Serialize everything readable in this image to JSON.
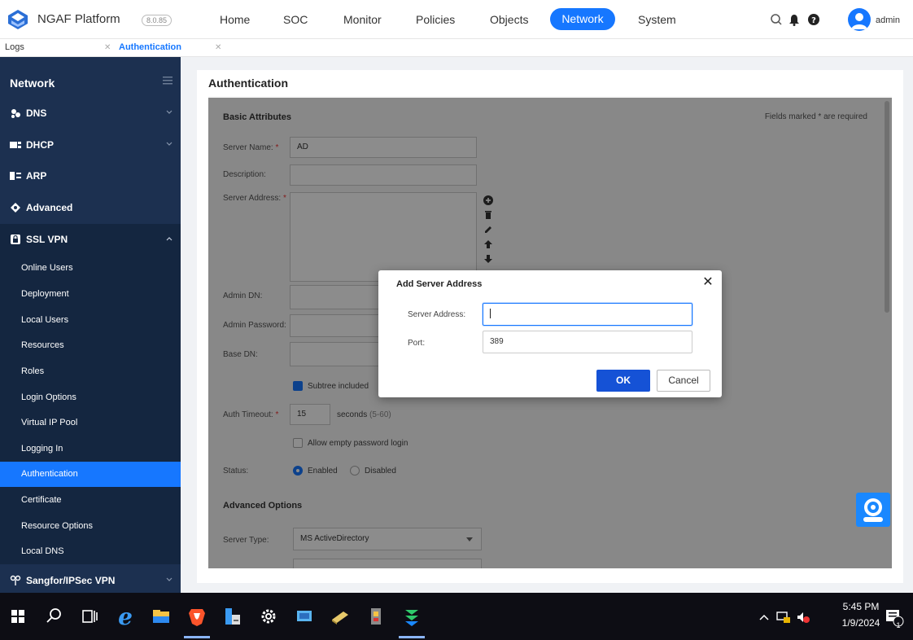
{
  "header": {
    "brand": "NGAF Platform",
    "version": "8.0.85",
    "nav": [
      "Home",
      "SOC",
      "Monitor",
      "Policies",
      "Objects",
      "Network",
      "System"
    ],
    "active_nav": "Network",
    "user": "admin",
    "accent": "#1677ff"
  },
  "tabs": [
    {
      "label": "Logs",
      "active": false
    },
    {
      "label": "Authentication",
      "active": true
    }
  ],
  "sidebar": {
    "title": "Network",
    "sections": [
      {
        "label": "DNS",
        "icon": "dns-icon"
      },
      {
        "label": "DHCP",
        "icon": "dhcp-icon"
      },
      {
        "label": "ARP",
        "icon": "arp-icon"
      },
      {
        "label": "Advanced",
        "icon": "advanced-icon"
      },
      {
        "label": "SSL VPN",
        "icon": "sslvpn-icon"
      }
    ],
    "ssl_items": [
      "Online Users",
      "Deployment",
      "Local Users",
      "Resources",
      "Roles",
      "Login Options",
      "Virtual IP Pool",
      "Logging In",
      "Authentication",
      "Certificate",
      "Resource Options",
      "Local DNS"
    ],
    "active_item": "Authentication",
    "footer_section": "Sangfor/IPSec VPN"
  },
  "panel": {
    "title": "Authentication",
    "basic_title": "Basic Attributes",
    "required_note": "Fields marked * are required",
    "server_name_label": "Server Name:",
    "server_name_value": "AD",
    "description_label": "Description:",
    "server_address_label": "Server Address:",
    "admin_dn_label": "Admin DN:",
    "admin_password_label": "Admin Password:",
    "base_dn_label": "Base DN:",
    "subtree_label": "Subtree included",
    "auth_timeout_label": "Auth Timeout:",
    "auth_timeout_value": "15",
    "seconds_label": "seconds",
    "seconds_range": "(5-60)",
    "allow_empty_label": "Allow empty password login",
    "status_label": "Status:",
    "enabled_label": "Enabled",
    "disabled_label": "Disabled",
    "advanced_title": "Advanced Options",
    "server_type_label": "Server Type:",
    "server_type_value": "MS ActiveDirectory",
    "required_mark": "*"
  },
  "dialog": {
    "title": "Add Server Address",
    "server_address_label": "Server Address:",
    "server_address_value": "",
    "port_label": "Port:",
    "port_value": "389",
    "ok_label": "OK",
    "cancel_label": "Cancel",
    "close_glyph": "✕"
  },
  "taskbar": {
    "time": "5:45 PM",
    "date": "1/9/2024",
    "notification_count": "1"
  }
}
